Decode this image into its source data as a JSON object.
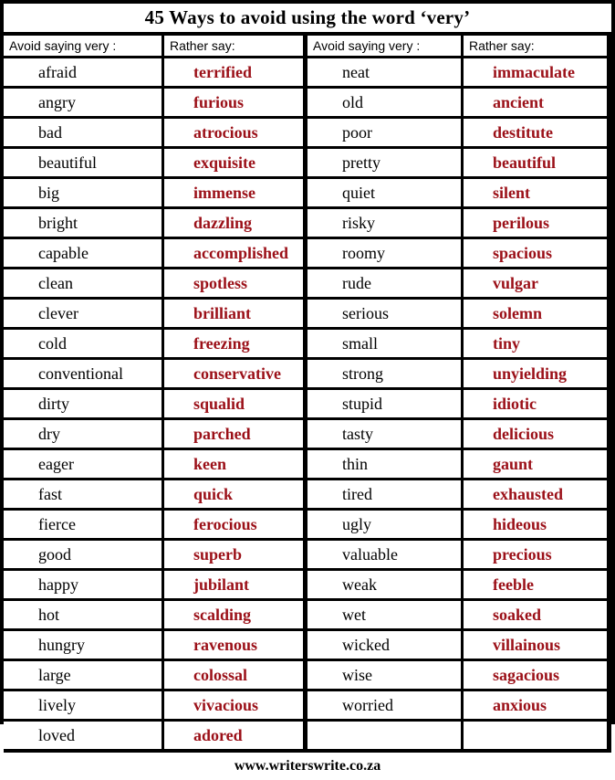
{
  "title": "45 Ways to avoid using the word ‘very’",
  "footer": "www.writerswrite.co.za",
  "colors": {
    "border": "#000000",
    "background": "#ffffff",
    "avoid_text": "#000000",
    "rather_text": "#9b1018"
  },
  "headers": {
    "col0": "Avoid saying very :",
    "col1": "Rather say:",
    "col2": "Avoid saying very :",
    "col3": "Rather say:"
  },
  "rows": [
    {
      "avoid_left": "afraid",
      "rather_left": "terrified",
      "avoid_right": "neat",
      "rather_right": "immaculate"
    },
    {
      "avoid_left": "angry",
      "rather_left": "furious",
      "avoid_right": "old",
      "rather_right": "ancient"
    },
    {
      "avoid_left": "bad",
      "rather_left": "atrocious",
      "avoid_right": "poor",
      "rather_right": "destitute"
    },
    {
      "avoid_left": "beautiful",
      "rather_left": "exquisite",
      "avoid_right": "pretty",
      "rather_right": "beautiful"
    },
    {
      "avoid_left": "big",
      "rather_left": "immense",
      "avoid_right": "quiet",
      "rather_right": "silent"
    },
    {
      "avoid_left": "bright",
      "rather_left": "dazzling",
      "avoid_right": "risky",
      "rather_right": "perilous"
    },
    {
      "avoid_left": "capable",
      "rather_left": "accomplished",
      "avoid_right": "roomy",
      "rather_right": "spacious"
    },
    {
      "avoid_left": "clean",
      "rather_left": "spotless",
      "avoid_right": "rude",
      "rather_right": "vulgar"
    },
    {
      "avoid_left": "clever",
      "rather_left": "brilliant",
      "avoid_right": "serious",
      "rather_right": "solemn"
    },
    {
      "avoid_left": "cold",
      "rather_left": "freezing",
      "avoid_right": "small",
      "rather_right": "tiny"
    },
    {
      "avoid_left": "conventional",
      "rather_left": "conservative",
      "avoid_right": "strong",
      "rather_right": "unyielding"
    },
    {
      "avoid_left": "dirty",
      "rather_left": "squalid",
      "avoid_right": "stupid",
      "rather_right": "idiotic"
    },
    {
      "avoid_left": "dry",
      "rather_left": "parched",
      "avoid_right": "tasty",
      "rather_right": "delicious"
    },
    {
      "avoid_left": "eager",
      "rather_left": "keen",
      "avoid_right": "thin",
      "rather_right": "gaunt"
    },
    {
      "avoid_left": "fast",
      "rather_left": "quick",
      "avoid_right": "tired",
      "rather_right": "exhausted"
    },
    {
      "avoid_left": "fierce",
      "rather_left": "ferocious",
      "avoid_right": "ugly",
      "rather_right": "hideous"
    },
    {
      "avoid_left": "good",
      "rather_left": "superb",
      "avoid_right": "valuable",
      "rather_right": "precious"
    },
    {
      "avoid_left": "happy",
      "rather_left": "jubilant",
      "avoid_right": "weak",
      "rather_right": "feeble"
    },
    {
      "avoid_left": "hot",
      "rather_left": "scalding",
      "avoid_right": "wet",
      "rather_right": "soaked"
    },
    {
      "avoid_left": "hungry",
      "rather_left": "ravenous",
      "avoid_right": "wicked",
      "rather_right": "villainous"
    },
    {
      "avoid_left": "large",
      "rather_left": "colossal",
      "avoid_right": "wise",
      "rather_right": "sagacious"
    },
    {
      "avoid_left": "lively",
      "rather_left": "vivacious",
      "avoid_right": "worried",
      "rather_right": "anxious"
    },
    {
      "avoid_left": "loved",
      "rather_left": "adored",
      "avoid_right": "",
      "rather_right": ""
    }
  ]
}
